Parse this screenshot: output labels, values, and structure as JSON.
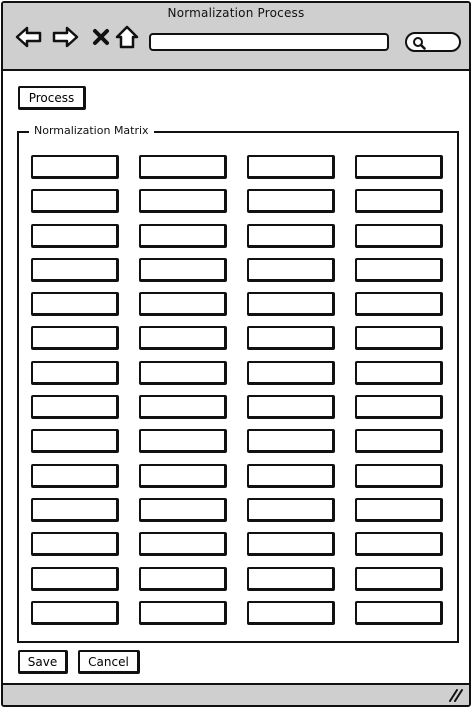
{
  "window": {
    "title": "Normalization Process"
  },
  "browser": {
    "back_icon": "back-arrow-icon",
    "forward_icon": "forward-arrow-icon",
    "stop_icon": "close-x-icon",
    "home_icon": "home-icon",
    "url_value": "",
    "search_icon": "search-icon"
  },
  "toolbar": {
    "process_label": "Process"
  },
  "matrix": {
    "legend": "Normalization Matrix",
    "rows": 14,
    "columns": 4
  },
  "footer": {
    "save_label": "Save",
    "cancel_label": "Cancel"
  }
}
